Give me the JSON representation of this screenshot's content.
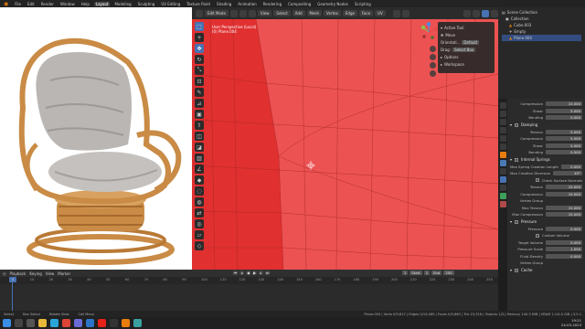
{
  "menu": {
    "items": [
      "File",
      "Edit",
      "Render",
      "Window",
      "Help"
    ],
    "workspaces": [
      "Layout",
      "Modeling",
      "Sculpting",
      "UV Editing",
      "Texture Paint",
      "Shading",
      "Animation",
      "Rendering",
      "Compositing",
      "Geometry Nodes",
      "Scripting"
    ],
    "active_workspace": "Layout"
  },
  "viewport_header": {
    "mode": "Edit Mode",
    "buttons": [
      "View",
      "Select",
      "Add",
      "Mesh",
      "Vertex",
      "Edge",
      "Face",
      "UV"
    ],
    "orientation": "Orientation",
    "orientation_value": "Default",
    "drag": "Drag",
    "drag_value": "Select Box",
    "transform_pivot": "Global"
  },
  "viewport": {
    "view_name": "User Perspective (Local)",
    "object_name": "(0) Plane.004",
    "background_color": "#e63c3c"
  },
  "npanel": {
    "title": "Active Tool",
    "tool": "Move",
    "orient_label": "Orientati...",
    "orient_value": "Default",
    "drag_label": "Drag:",
    "drag_value": "Select Box",
    "options": "Options",
    "workspace": "Workspace"
  },
  "outliner": {
    "items": [
      {
        "label": "Scene Collection",
        "selected": false
      },
      {
        "label": "Collection",
        "selected": false
      },
      {
        "label": "Cube.003",
        "selected": false
      },
      {
        "label": "Empty",
        "selected": false
      },
      {
        "label": "Plane.004",
        "selected": true
      }
    ]
  },
  "properties": {
    "rows": [
      {
        "type": "field",
        "label": "Compression",
        "value": "15.000"
      },
      {
        "type": "field",
        "label": "Shear",
        "value": "5.000"
      },
      {
        "type": "field",
        "label": "Bending",
        "value": "0.500"
      },
      {
        "type": "section",
        "label": "Damping"
      },
      {
        "type": "field",
        "label": "Tension",
        "value": "5.000"
      },
      {
        "type": "field",
        "label": "Compression",
        "value": "5.000"
      },
      {
        "type": "field",
        "label": "Shear",
        "value": "5.000"
      },
      {
        "type": "field",
        "label": "Bending",
        "value": "0.500"
      },
      {
        "type": "section",
        "label": "Internal Springs"
      },
      {
        "type": "field",
        "label": "Max Spring Creation Length",
        "value": "0.000"
      },
      {
        "type": "field",
        "label": "Max Creation Diversion",
        "value": "45°"
      },
      {
        "type": "check",
        "label": "Check Surface Normals"
      },
      {
        "type": "field",
        "label": "Tension",
        "value": "15.000"
      },
      {
        "type": "field",
        "label": "Compression",
        "value": "15.000"
      },
      {
        "type": "field",
        "label": "Vertex Group",
        "value": ""
      },
      {
        "type": "field",
        "label": "Max Tension",
        "value": "15.000"
      },
      {
        "type": "field",
        "label": "Max Compression",
        "value": "15.000"
      },
      {
        "type": "section",
        "label": "Pressure"
      },
      {
        "type": "field",
        "label": "Pressure",
        "value": "0.000"
      },
      {
        "type": "check",
        "label": "Custom Volume"
      },
      {
        "type": "field",
        "label": "Target Volume",
        "value": "0.000"
      },
      {
        "type": "field",
        "label": "Pressure Scale",
        "value": "1.000"
      },
      {
        "type": "field",
        "label": "Fluid Density",
        "value": "0.000"
      },
      {
        "type": "field",
        "label": "Vertex Group",
        "value": ""
      },
      {
        "type": "section",
        "label": "Cache"
      }
    ]
  },
  "timeline": {
    "header": [
      "Playback",
      "Keying",
      "View",
      "Marker"
    ],
    "current_frame": "1",
    "ruler": [
      "0",
      "10",
      "20",
      "30",
      "40",
      "50",
      "60",
      "70",
      "80",
      "90",
      "100",
      "110",
      "120",
      "130",
      "140",
      "150",
      "160",
      "170",
      "180",
      "190",
      "200",
      "210",
      "220",
      "230",
      "240",
      "250"
    ],
    "start_label": "Start",
    "start_value": "1",
    "end_label": "End",
    "end_value": "250"
  },
  "statusbar": {
    "items": [
      "Select",
      "Box Select",
      "Rotate View",
      "Call Menu"
    ],
    "info": "Plane.004 | Verts 0/9,817 | Edges 0/19,469 | Faces 0/9,660 | Tris 19,316 | Objects 1/3 | Memory 140.3 MiB | VRAM 1.1/4.0 GiB | 3.5.1"
  },
  "taskbar": {
    "time": "19:21",
    "date": "24-03-2023"
  }
}
